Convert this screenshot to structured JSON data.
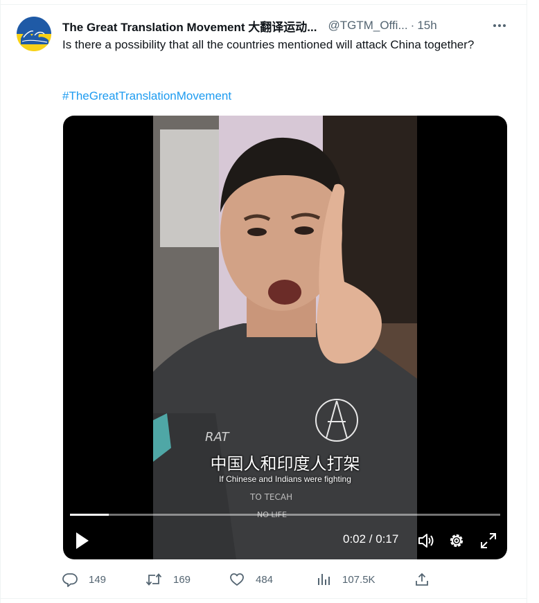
{
  "tweet": {
    "display_name": "The Great Translation Movement 大翻译运动...",
    "handle": "@TGTM_Offi...",
    "separator": "·",
    "time": "15h",
    "text": "Is there a possibility that all the countries mentioned will attack China together?",
    "hashtag": "#TheGreatTranslationMovement"
  },
  "video": {
    "subtitle_zh": "中国人和印度人打架",
    "subtitle_en": "If Chinese and Indians were fighting",
    "time_readout": "0:02 / 0:17",
    "progress": 0.09
  },
  "actions": {
    "replies": "149",
    "retweets": "169",
    "likes": "484",
    "views": "107.5K"
  },
  "icons": [
    "avatar-wave-logo",
    "more-icon",
    "play-icon",
    "volume-icon",
    "settings-icon",
    "fullscreen-icon",
    "reply-icon",
    "retweet-icon",
    "like-icon",
    "views-icon",
    "share-icon"
  ],
  "colors": {
    "link": "#1d9bf0",
    "secondary_text": "#536471",
    "primary_text": "#0f1419",
    "avatar_blue": "#1f5aa6",
    "avatar_yellow": "#f7d117"
  }
}
